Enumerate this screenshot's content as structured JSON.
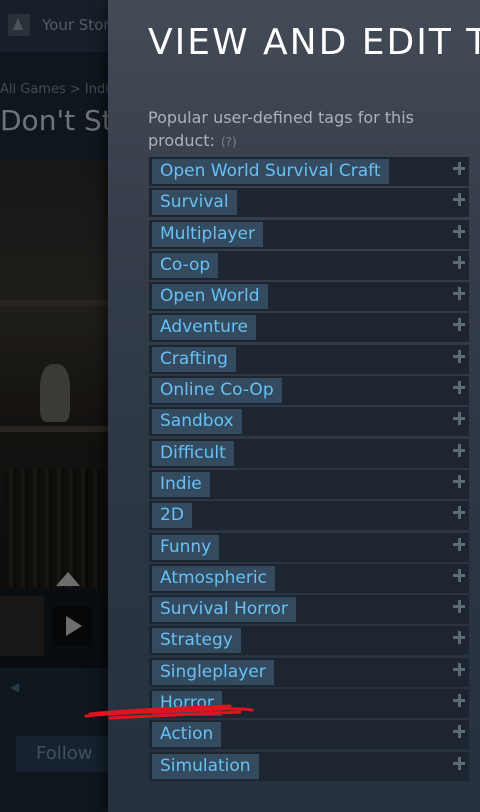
{
  "background": {
    "store_label": "Your Store",
    "breadcrumb": "All Games > Indie",
    "game_title": "Don't Starve",
    "follow_label": "Follow"
  },
  "modal": {
    "title": "VIEW AND EDIT TAGS",
    "description": "Popular user-defined tags for this product:",
    "help_label": "(?)",
    "tags": [
      "Open World Survival Craft",
      "Survival",
      "Multiplayer",
      "Co-op",
      "Open World",
      "Adventure",
      "Crafting",
      "Online Co-Op",
      "Sandbox",
      "Difficult",
      "Indie",
      "2D",
      "Funny",
      "Atmospheric",
      "Survival Horror",
      "Strategy",
      "Singleplayer",
      "Horror",
      "Action",
      "Simulation"
    ]
  },
  "colors": {
    "tag_text": "#67c1f5",
    "tag_bg": "#344a5f",
    "annotation": "#e0141e"
  }
}
